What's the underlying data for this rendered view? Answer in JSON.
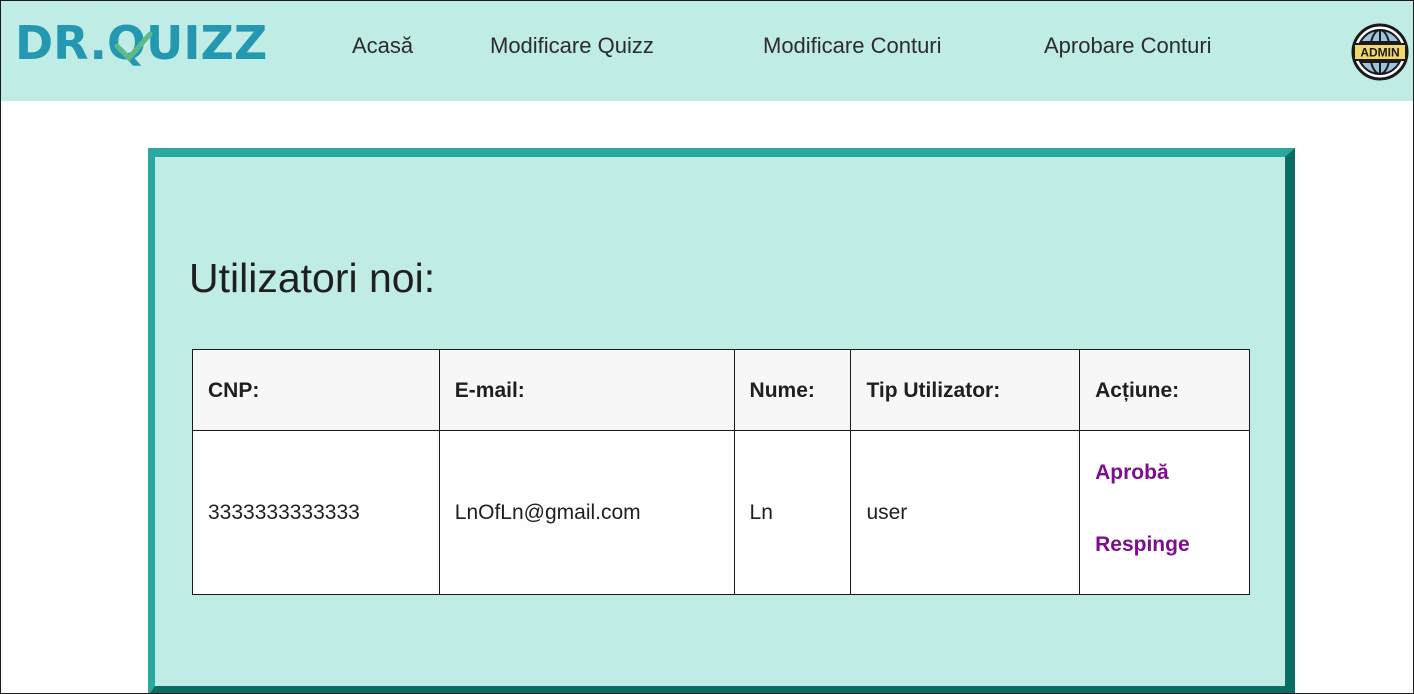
{
  "header": {
    "logo_prefix": "DR.",
    "logo_q": "Q",
    "logo_suffix": "UIZZ",
    "nav": [
      "Acasă",
      "Modificare Quizz",
      "Modificare Conturi",
      "Aprobare Conturi"
    ],
    "avatar_text": "ADMIN"
  },
  "main": {
    "title": "Utilizatori noi:",
    "table": {
      "headers": [
        "CNP:",
        "E-mail:",
        "Nume:",
        "Tip Utilizator:",
        "Acțiune:"
      ],
      "rows": [
        {
          "cnp": "3333333333333",
          "email": "LnOfLn@gmail.com",
          "nume": "Ln",
          "tip": "user",
          "approve": "Aprobă",
          "reject": "Respinge"
        }
      ]
    }
  },
  "colors": {
    "header_bg": "#c0ece6",
    "logo": "#2498b1",
    "logo_check": "#5fba8a",
    "card_border_light": "#28a99c",
    "card_border_dark": "#0b6c62",
    "action_link": "#7b0f8c"
  }
}
